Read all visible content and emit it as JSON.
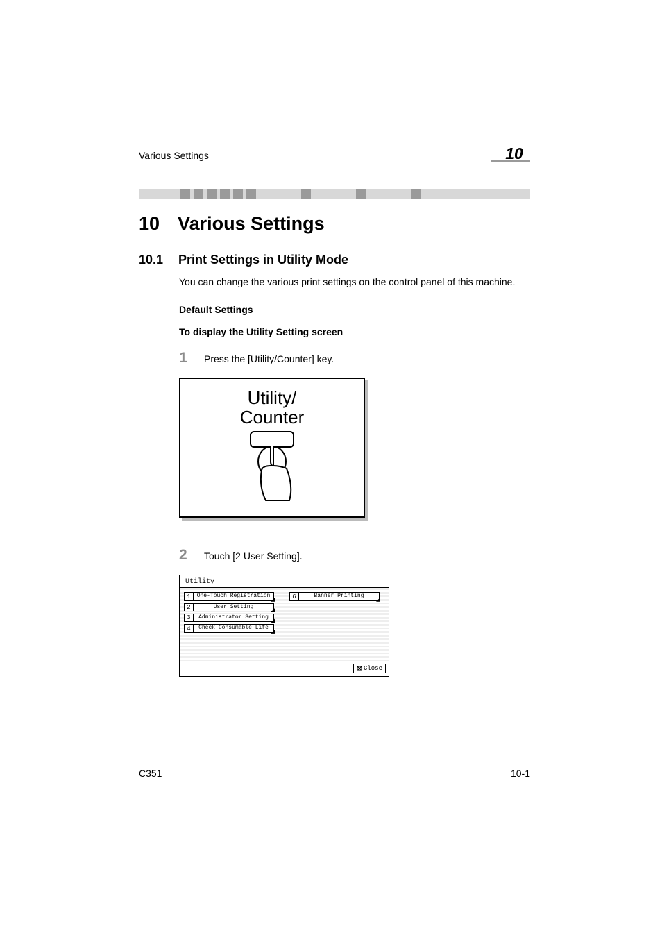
{
  "header": {
    "running_head": "Various Settings",
    "chapter_badge": "10"
  },
  "chapter": {
    "number": "10",
    "title": "Various Settings"
  },
  "section": {
    "number": "10.1",
    "title": "Print Settings in Utility Mode"
  },
  "intro_paragraph": "You can change the various print settings on the control panel of this machine.",
  "subheadings": {
    "default_settings": "Default Settings",
    "to_display": "To display the Utility Setting screen"
  },
  "steps": {
    "s1": {
      "num": "1",
      "text": "Press the [Utility/Counter] key."
    },
    "s2": {
      "num": "2",
      "text": "Touch [2 User Setting]."
    }
  },
  "figure1": {
    "line1": "Utility/",
    "line2": "Counter"
  },
  "figure2": {
    "title": "Utility",
    "items_left": [
      {
        "n": "1",
        "label": "One-Touch Registration"
      },
      {
        "n": "2",
        "label": "User Setting"
      },
      {
        "n": "3",
        "label": "Administrator Setting"
      },
      {
        "n": "4",
        "label": "Check Consumable Life"
      }
    ],
    "items_right": [
      {
        "n": "6",
        "label": "Banner Printing"
      }
    ],
    "close": "Close"
  },
  "footer": {
    "model": "C351",
    "page": "10-1"
  }
}
